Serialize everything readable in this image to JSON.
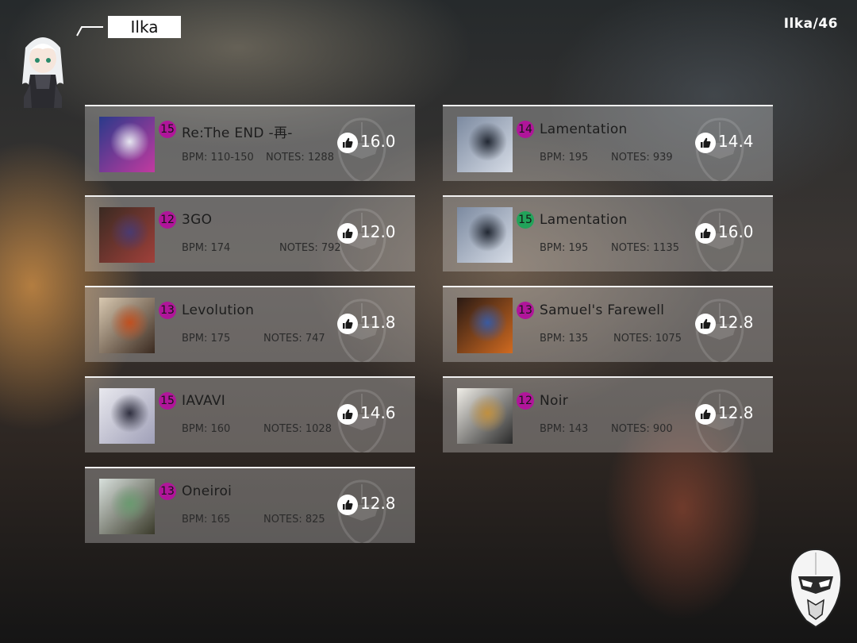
{
  "player": {
    "name": "Ilka",
    "progress": "Ilka/46",
    "avatar_icon": "chibi-character-avatar"
  },
  "colors": {
    "level_magenta": "#b0159a",
    "level_green": "#22a35a",
    "card_background": "rgba(235,235,235,0.30)"
  },
  "songs": [
    {
      "title": "Re:The END -再-",
      "level": "15",
      "level_color": "#b0159a",
      "bpm": "BPM: 110-150",
      "notes": "NOTES: 1288",
      "rating": "16.0"
    },
    {
      "title": "Lamentation",
      "level": "14",
      "level_color": "#b0159a",
      "bpm": "BPM: 195",
      "notes": "NOTES: 939",
      "rating": "14.4"
    },
    {
      "title": "3GO",
      "level": "12",
      "level_color": "#b0159a",
      "bpm": "BPM: 174",
      "notes": "NOTES: 792",
      "rating": "12.0"
    },
    {
      "title": "Lamentation",
      "level": "15",
      "level_color": "#22a35a",
      "bpm": "BPM: 195",
      "notes": "NOTES: 1135",
      "rating": "16.0"
    },
    {
      "title": "Levolution",
      "level": "13",
      "level_color": "#b0159a",
      "bpm": "BPM: 175",
      "notes": "NOTES: 747",
      "rating": "11.8"
    },
    {
      "title": "Samuel's Farewell",
      "level": "13",
      "level_color": "#b0159a",
      "bpm": "BPM: 135",
      "notes": "NOTES: 1075",
      "rating": "12.8"
    },
    {
      "title": "IAVAVI",
      "level": "15",
      "level_color": "#b0159a",
      "bpm": "BPM: 160",
      "notes": "NOTES: 1028",
      "rating": "14.6"
    },
    {
      "title": "Noir",
      "level": "12",
      "level_color": "#b0159a",
      "bpm": "BPM: 143",
      "notes": "NOTES: 900",
      "rating": "12.8"
    },
    {
      "title": "Oneiroi",
      "level": "13",
      "level_color": "#b0159a",
      "bpm": "BPM: 165",
      "notes": "NOTES: 825",
      "rating": "12.8"
    }
  ]
}
